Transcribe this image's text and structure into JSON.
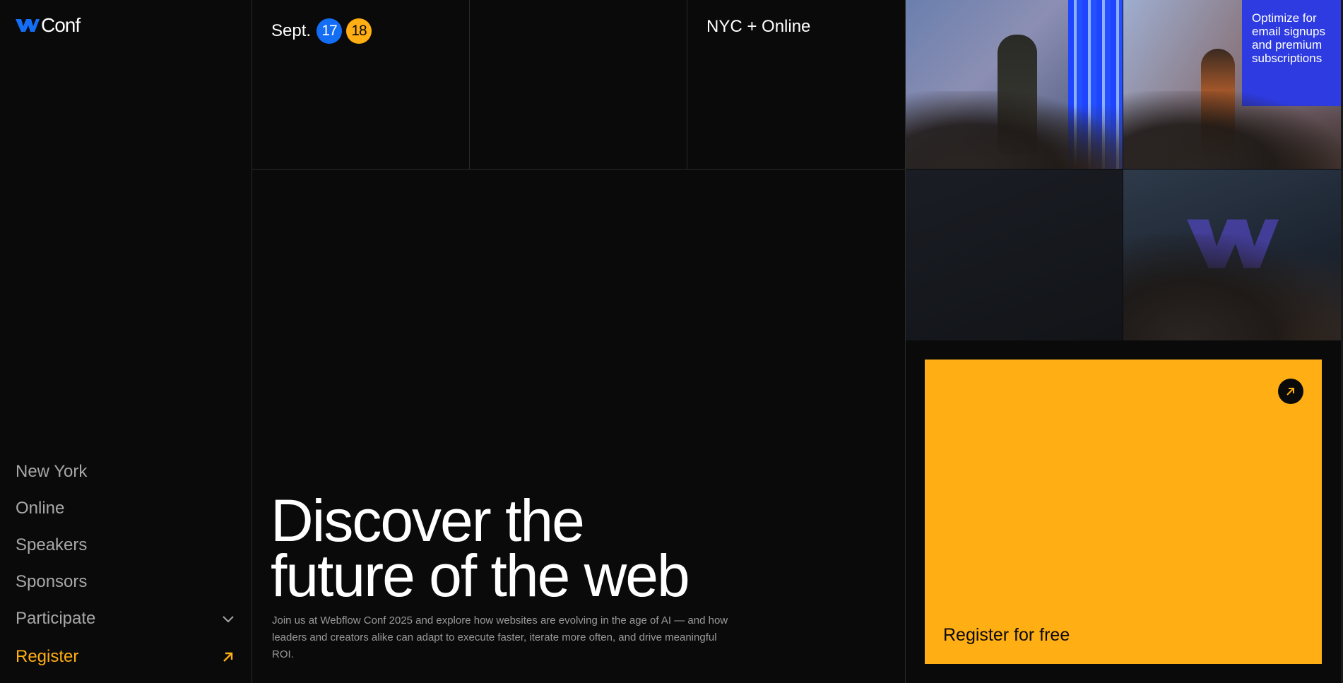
{
  "brand": {
    "name": "Conf",
    "accent": "#ffae13",
    "blue": "#146ef5",
    "background": "#0a0a0a"
  },
  "event": {
    "month": "Sept.",
    "day_one": "17",
    "day_two": "18",
    "location": "NYC + Online"
  },
  "nav": {
    "items": [
      {
        "label": "New York"
      },
      {
        "label": "Online"
      },
      {
        "label": "Speakers"
      },
      {
        "label": "Sponsors"
      },
      {
        "label": "Participate",
        "icon": "chevron-down-icon"
      }
    ],
    "register": {
      "label": "Register",
      "icon": "arrow-up-right-icon"
    }
  },
  "hero": {
    "headline_line1": "Discover the",
    "headline_line2": "future of the web",
    "description": "Join us at Webflow Conf 2025 and explore how websites are evolving in the age of AI — and how leaders and creators alike can adapt to execute faster, iterate more often, and drive meaningful ROI."
  },
  "photos": {
    "screen_text": "Optimize for email signups and premium subscriptions"
  },
  "cta": {
    "label": "Register for free",
    "icon": "arrow-up-right-icon"
  }
}
